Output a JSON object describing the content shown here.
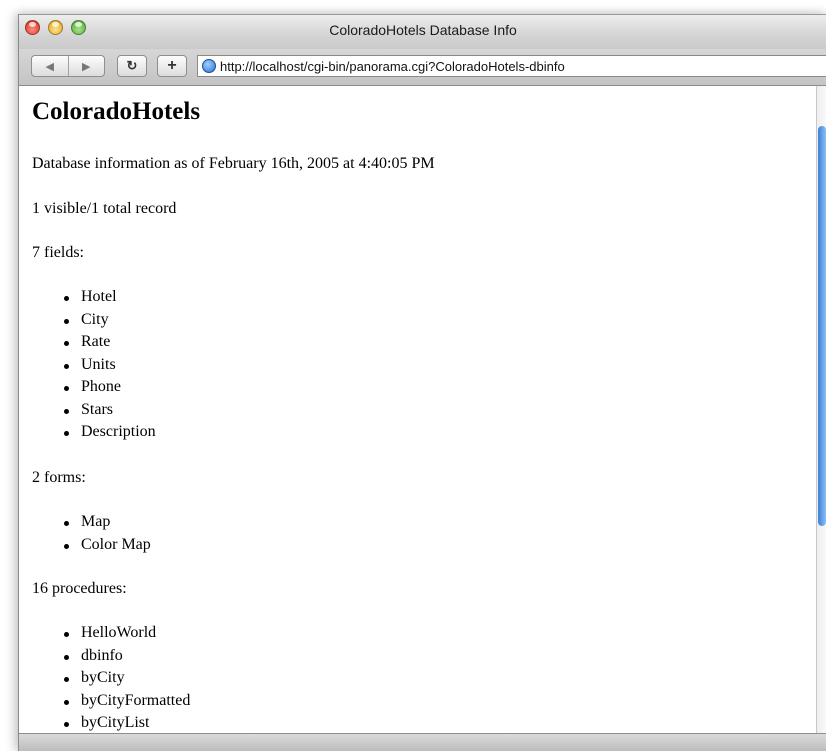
{
  "window": {
    "title": "ColoradoHotels Database Info"
  },
  "toolbar": {
    "back_icon": "back-arrow-icon",
    "forward_icon": "forward-arrow-icon",
    "reload_icon": "reload-icon",
    "add_bookmark_icon": "plus-icon",
    "url": "http://localhost/cgi-bin/panorama.cgi?ColoradoHotels-dbinfo"
  },
  "page": {
    "heading": "ColoradoHotels",
    "info_line": "Database information as of February 16th, 2005 at 4:40:05 PM",
    "records_line": "1 visible/1 total record",
    "fields_label": "7 fields:",
    "fields": [
      "Hotel",
      "City",
      "Rate",
      "Units",
      "Phone",
      "Stars",
      "Description"
    ],
    "forms_label": "2 forms:",
    "forms": [
      "Map",
      "Color Map"
    ],
    "procedures_label": "16 procedures:",
    "procedures": [
      "HelloWorld",
      "dbinfo",
      "byCity",
      "byCityFormatted",
      "byCityList"
    ]
  },
  "colors": {
    "scroll_thumb": "#3c7fd8",
    "close_button": "#d8261b",
    "minimize_button": "#e0a516",
    "zoom_button": "#4aa82a"
  }
}
